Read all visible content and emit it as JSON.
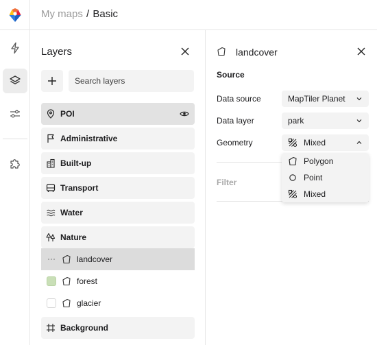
{
  "breadcrumb": {
    "parent": "My maps",
    "separator": "/",
    "current": "Basic"
  },
  "rail": {
    "items": [
      {
        "icon": "bolt-icon",
        "active": false
      },
      {
        "icon": "layers-icon",
        "active": true
      },
      {
        "icon": "sliders-icon",
        "active": false
      },
      {
        "icon": "puzzle-icon",
        "active": false
      }
    ]
  },
  "layers_panel": {
    "title": "Layers",
    "search_placeholder": "Search layers",
    "groups": [
      {
        "label": "POI",
        "icon": "pin-icon",
        "highlighted": true
      },
      {
        "label": "Administrative",
        "icon": "flag-icon"
      },
      {
        "label": "Built-up",
        "icon": "building-icon"
      },
      {
        "label": "Transport",
        "icon": "bus-icon"
      },
      {
        "label": "Water",
        "icon": "waves-icon"
      },
      {
        "label": "Nature",
        "icon": "trees-icon"
      }
    ],
    "nature_layers": [
      {
        "label": "landcover",
        "swatch": null,
        "selected": true
      },
      {
        "label": "forest",
        "swatch": "#c9dfb7",
        "selected": false
      },
      {
        "label": "glacier",
        "swatch": "#ffffff",
        "selected": false
      }
    ],
    "background_group": {
      "label": "Background",
      "icon": "frame-icon"
    }
  },
  "detail": {
    "title": "landcover",
    "source_heading": "Source",
    "fields": {
      "data_source": {
        "label": "Data source",
        "value": "MapTiler Planet"
      },
      "data_layer": {
        "label": "Data layer",
        "value": "park"
      },
      "geometry": {
        "label": "Geometry",
        "value": "Mixed"
      }
    },
    "geometry_options": [
      {
        "label": "Polygon",
        "icon": "polygon-icon"
      },
      {
        "label": "Point",
        "icon": "circle-icon"
      },
      {
        "label": "Mixed",
        "icon": "mixed-icon"
      }
    ],
    "filter_heading": "Filter"
  },
  "colors": {
    "accent_red": "#e6233c",
    "accent_blue": "#2f7ddf",
    "accent_yellow": "#ffc21a",
    "panel_gray": "#f3f3f3",
    "forest_swatch": "#c9dfb7"
  }
}
